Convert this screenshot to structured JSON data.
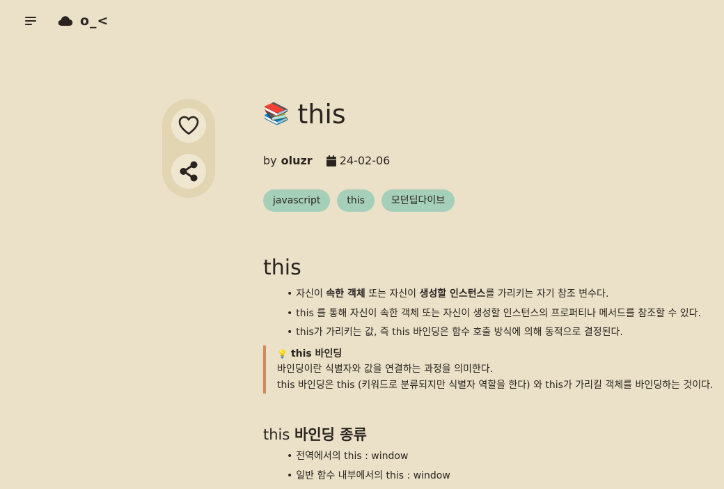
{
  "header": {
    "menu_icon": "hamburger-menu-icon",
    "logo_icon": "cloud-icon",
    "logo_text": "o_<"
  },
  "actions": {
    "like_icon": "heart-icon",
    "share_icon": "share-icon"
  },
  "post": {
    "title_emoji": "📚",
    "title": "this",
    "by_label": "by",
    "author": "oluzr",
    "date_icon": "calendar-icon",
    "date": "24-02-06",
    "tags": [
      "javascript",
      "this",
      "모던딥다이브"
    ]
  },
  "content": {
    "heading1": "this",
    "bullets1": [
      {
        "pre": "자신이 ",
        "b1": "속한 객체",
        "mid": " 또는 자신이 ",
        "b2": "생성할 인스턴스",
        "post": "를 가리키는 자기 참조 변수다."
      },
      {
        "text": "this 를 통해 자신이 속한 객체 또는 자신이 생성할 인스턴스의 프로퍼티나 메서드를 참조할 수 있다."
      },
      {
        "text": "this가 가리키는 값, 즉 this 바인딩은 함수 호출 방식에 의해 동적으로 결정된다."
      }
    ],
    "callout": {
      "icon": "💡",
      "title": "this 바인딩",
      "line1": "바인딩이란 식별자와 값을 연결하는 과정을 의미한다.",
      "line2": "this 바인딩은 this (키워드로 분류되지만 식별자 역할을 한다) 와 this가 가리킬 객체를 바인딩하는 것이다."
    },
    "heading2": {
      "plain": "this ",
      "bold": "바인딩 종류"
    },
    "bullets2": [
      "전역에서의 this : window",
      "일반 함수 내부에서의 this : window"
    ]
  },
  "colors": {
    "background": "#ebe1c8",
    "tag_bg": "#a5cfb9",
    "callout_border": "#d28a5c",
    "rail_bg": "#e2d5b1"
  }
}
